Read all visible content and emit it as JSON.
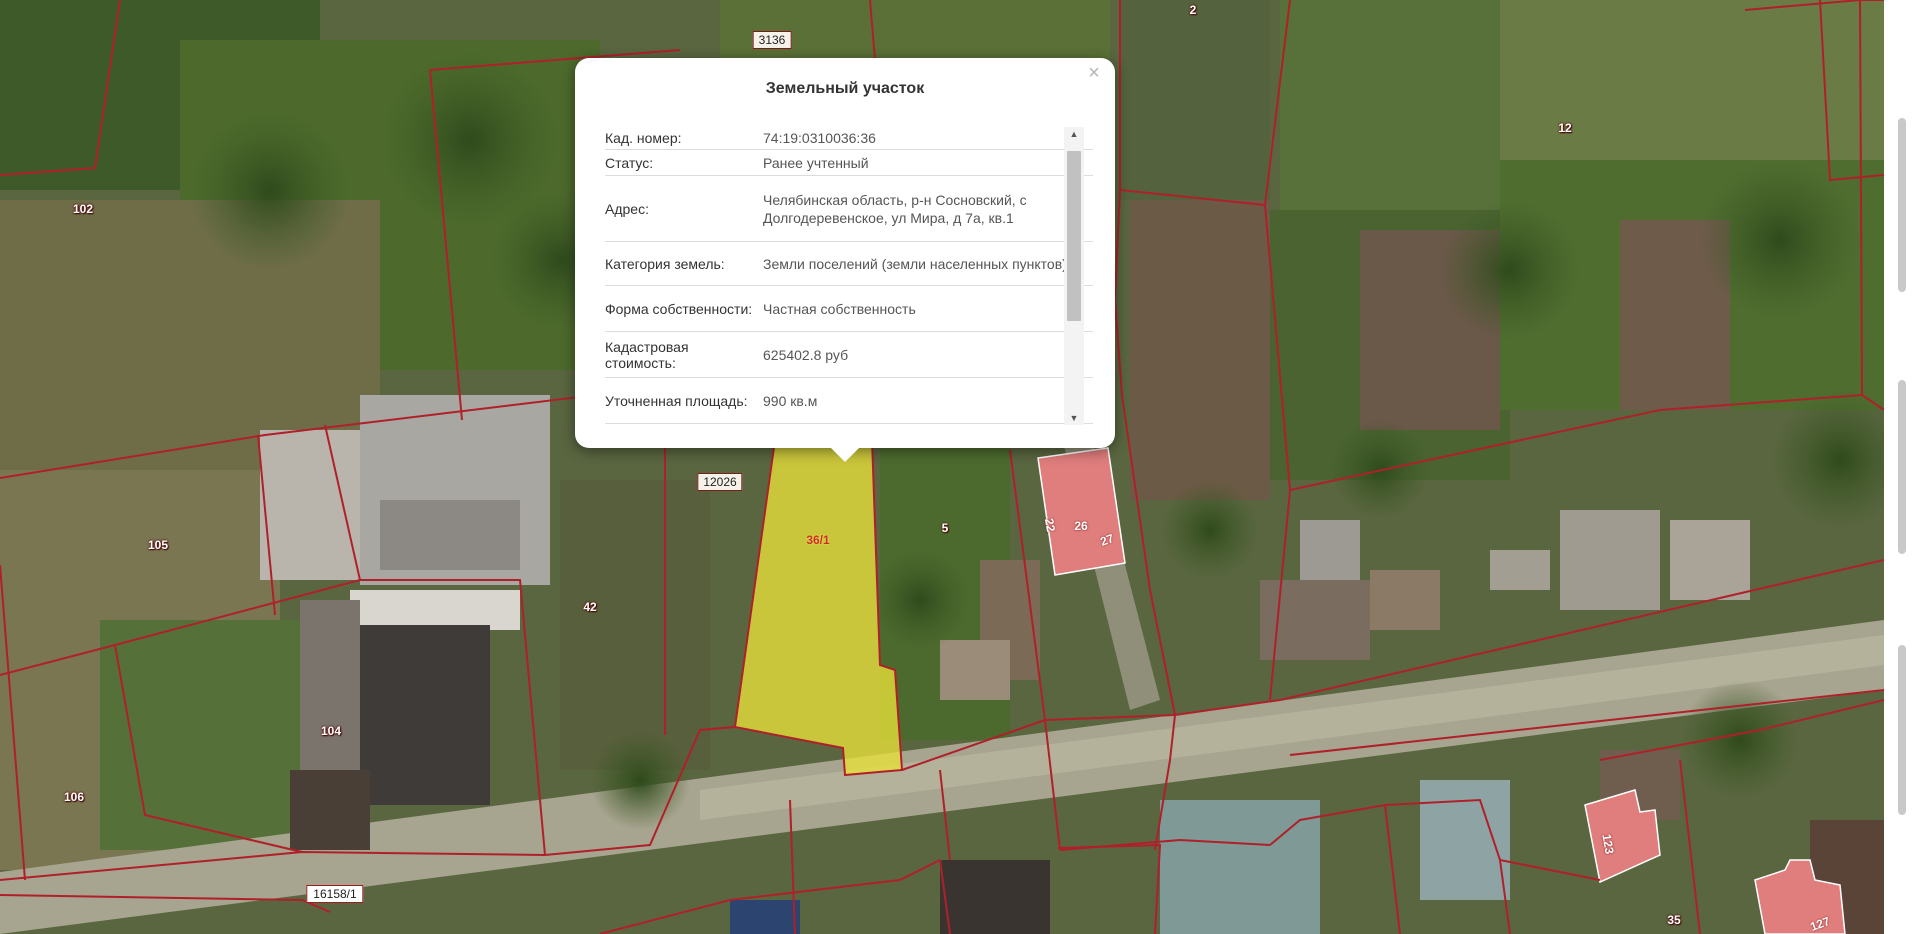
{
  "popup": {
    "title": "Земельный участок",
    "close_label": "×",
    "scroll_up": "▲",
    "scroll_down": "▼",
    "rows": [
      {
        "key": "Кад. номер:",
        "value": "74:19:0310036:36"
      },
      {
        "key": "Статус:",
        "value": "Ранее учтенный"
      },
      {
        "key": "Адрес:",
        "value": "Челябинская область, р-н Сосновский, с Долгодеревенское, ул Мира, д 7а, кв.1"
      },
      {
        "key": "Категория земель:",
        "value": "Земли поселений (земли населенных пунктов)"
      },
      {
        "key": "Форма собственности:",
        "value": "Частная собственность"
      },
      {
        "key": "Кадастровая стоимость:",
        "value": "625402.8 руб"
      },
      {
        "key": "Уточненная площадь:",
        "value": "990 кв.м"
      }
    ]
  },
  "map_labels": {
    "p3136": "3136",
    "p2": "2",
    "p102": "102",
    "p12": "12",
    "p12026": "12026",
    "p36_1": "36/1",
    "p5": "5",
    "p22": "22",
    "p26": "26",
    "p27": "27",
    "p105": "105",
    "p42": "42",
    "p104": "104",
    "p106": "106",
    "p16158": "16158/1",
    "p123": "123",
    "p35": "35",
    "p127": "127"
  },
  "colors": {
    "boundary": "#b0202a",
    "selected_fill": "#e8e23a",
    "building_fill": "#e07d7d",
    "popup_bg": "#ffffff"
  }
}
